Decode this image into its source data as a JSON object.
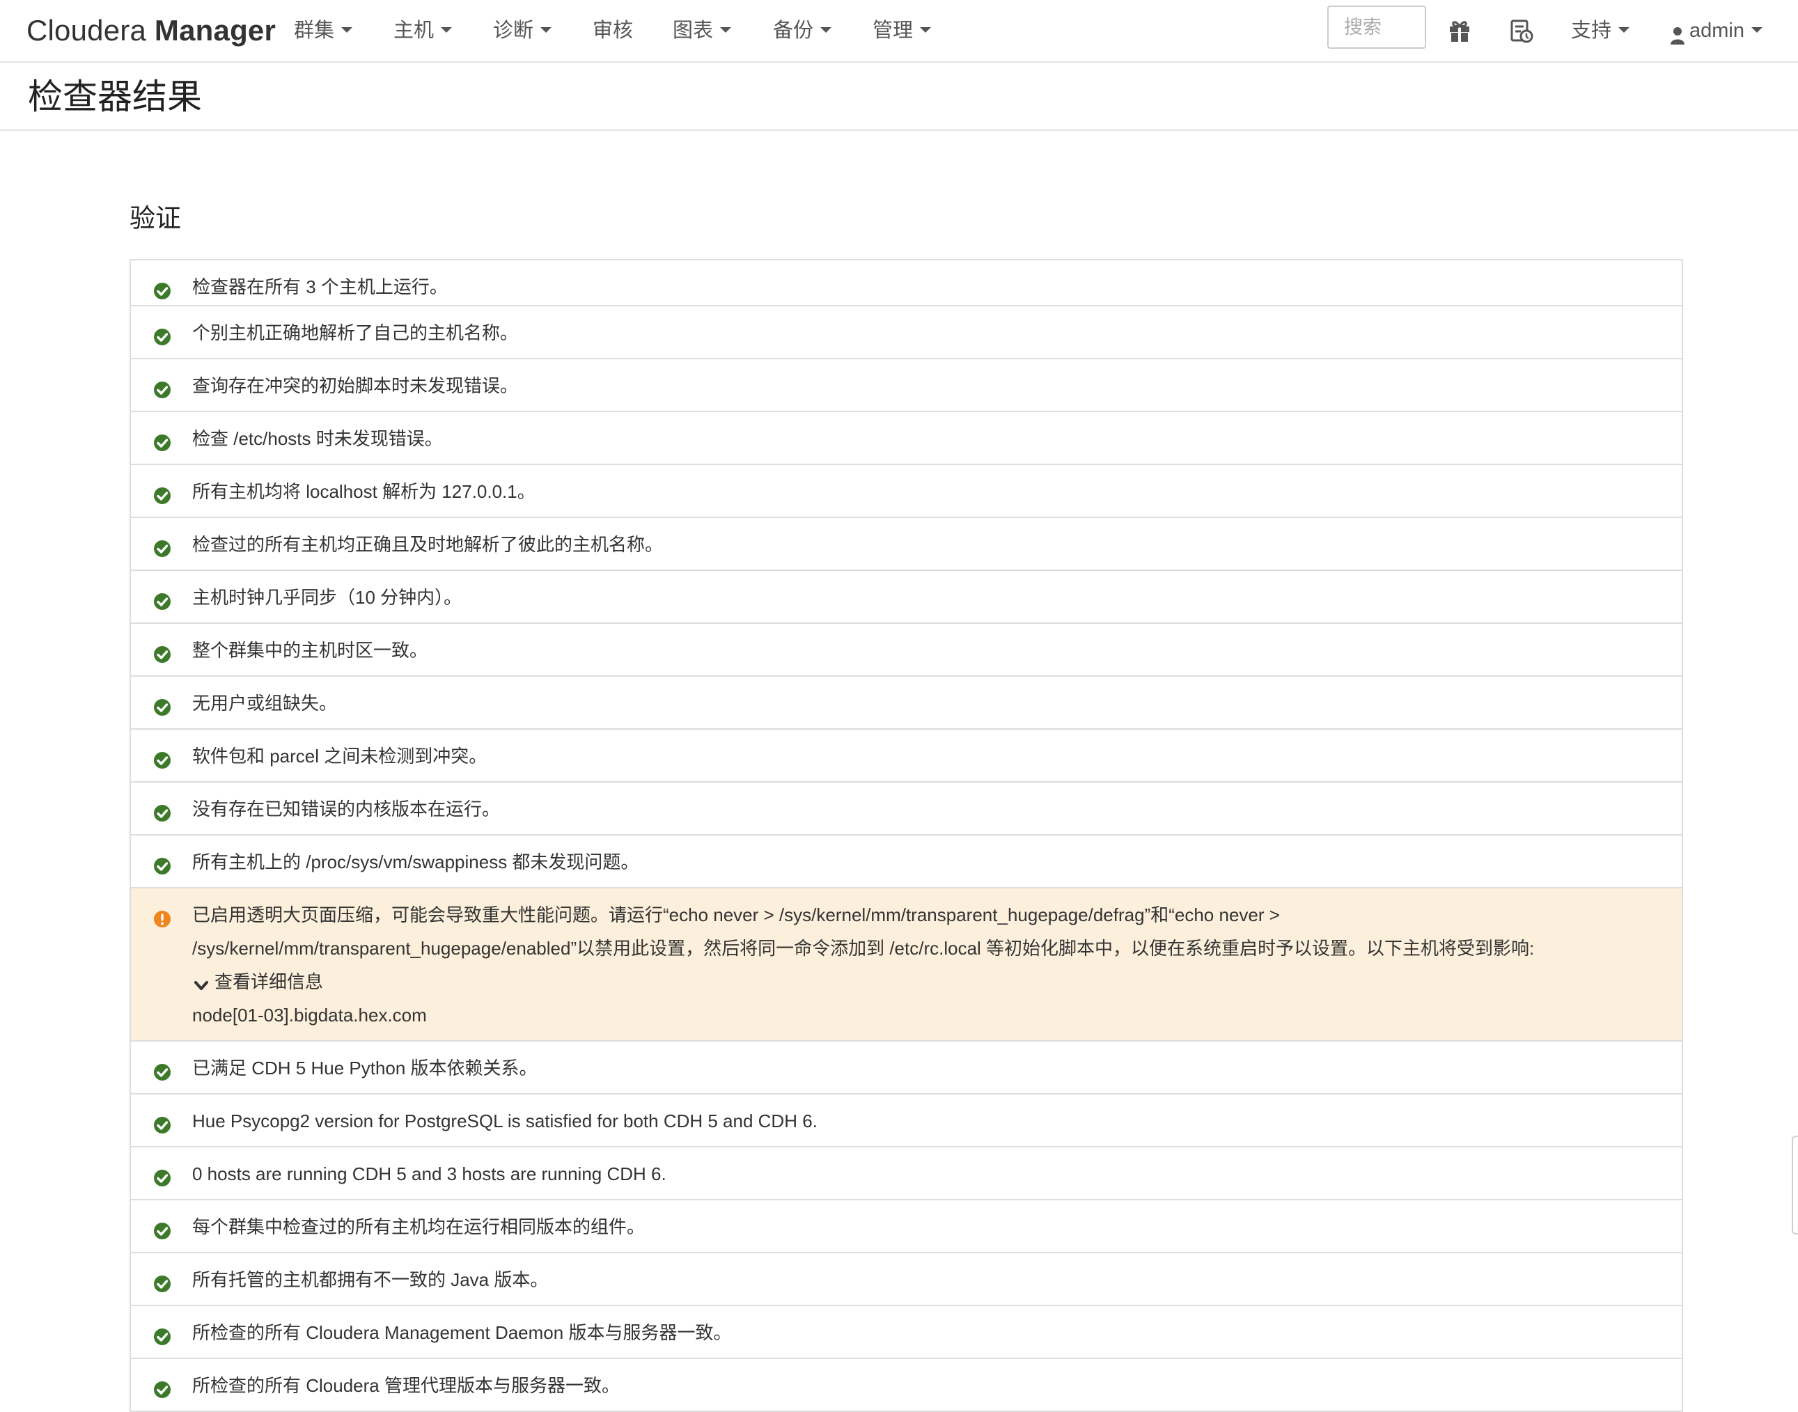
{
  "navbar": {
    "brand_light": "Cloudera",
    "brand_bold": "Manager",
    "menu": [
      {
        "label": "群集",
        "dropdown": true
      },
      {
        "label": "主机",
        "dropdown": true
      },
      {
        "label": "诊断",
        "dropdown": true
      },
      {
        "label": "审核",
        "dropdown": false
      },
      {
        "label": "图表",
        "dropdown": true
      },
      {
        "label": "备份",
        "dropdown": true
      },
      {
        "label": "管理",
        "dropdown": true
      }
    ],
    "search_placeholder": "搜索",
    "gift_icon": "gift-icon",
    "tasks_icon": "running-commands-icon",
    "support_label": "支持",
    "user_label": "admin",
    "user_icon": "user-icon"
  },
  "page": {
    "title": "检查器结果"
  },
  "section": {
    "title": "验证"
  },
  "colors": {
    "ok": "#3c7a2a",
    "warning": "#f0851d",
    "warning_bg": "#fcf0dc",
    "border": "#dddddd"
  },
  "results": [
    {
      "status": "ok",
      "text": "检查器在所有 3 个主机上运行。"
    },
    {
      "status": "ok",
      "text": "个别主机正确地解析了自己的主机名称。"
    },
    {
      "status": "ok",
      "text": "查询存在冲突的初始脚本时未发现错误。"
    },
    {
      "status": "ok",
      "text": "检查 /etc/hosts 时未发现错误。"
    },
    {
      "status": "ok",
      "text": "所有主机均将 localhost 解析为 127.0.0.1。"
    },
    {
      "status": "ok",
      "text": "检查过的所有主机均正确且及时地解析了彼此的主机名称。"
    },
    {
      "status": "ok",
      "text": "主机时钟几乎同步（10 分钟内）。"
    },
    {
      "status": "ok",
      "text": "整个群集中的主机时区一致。"
    },
    {
      "status": "ok",
      "text": "无用户或组缺失。"
    },
    {
      "status": "ok",
      "text": "软件包和 parcel 之间未检测到冲突。"
    },
    {
      "status": "ok",
      "text": "没有存在已知错误的内核版本在运行。"
    },
    {
      "status": "ok",
      "text": "所有主机上的 /proc/sys/vm/swappiness 都未发现问题。"
    },
    {
      "status": "warning",
      "text_line1": "已启用透明大页面压缩，可能会导致重大性能问题。请运行“echo never > /sys/kernel/mm/transparent_hugepage/defrag”和“echo never >",
      "text_line2": "/sys/kernel/mm/transparent_hugepage/enabled”以禁用此设置，然后将同一命令添加到 /etc/rc.local 等初始化脚本中，以便在系统重启时予以设置。以下主机将受到影响:",
      "details_label": "查看详细信息",
      "hosts": "node[01-03].bigdata.hex.com"
    },
    {
      "status": "ok",
      "text": "已满足 CDH 5 Hue Python 版本依赖关系。"
    },
    {
      "status": "ok",
      "text": "Hue Psycopg2 version for PostgreSQL is satisfied for both CDH 5 and CDH 6."
    },
    {
      "status": "ok",
      "text": "0 hosts are running CDH 5 and 3 hosts are running CDH 6."
    },
    {
      "status": "ok",
      "text": "每个群集中检查过的所有主机均在运行相同版本的组件。"
    },
    {
      "status": "ok",
      "text": "所有托管的主机都拥有不一致的 Java 版本。"
    },
    {
      "status": "ok",
      "text": "所检查的所有 Cloudera Management Daemon 版本与服务器一致。"
    },
    {
      "status": "ok",
      "text": "所检查的所有 Cloudera 管理代理版本与服务器一致。"
    }
  ]
}
